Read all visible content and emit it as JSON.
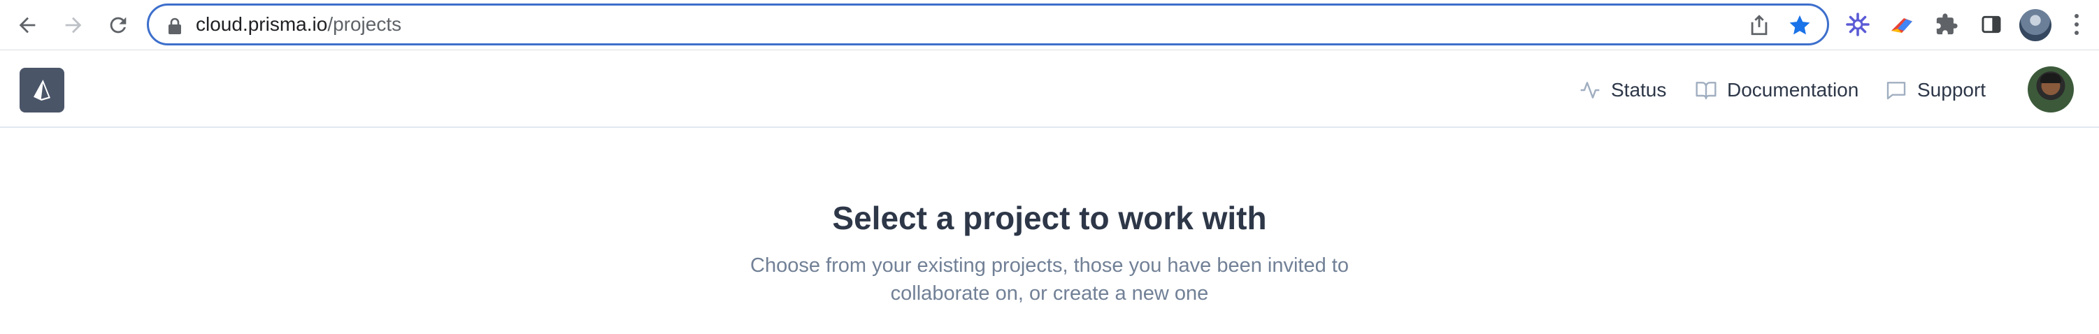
{
  "browser": {
    "url_domain": "cloud.prisma.io",
    "url_path": "/projects",
    "icons": [
      "back-icon",
      "forward-icon",
      "reload-icon",
      "lock-icon",
      "share-icon",
      "star-icon",
      "perplexity-extension-icon",
      "arrow-extension-icon",
      "puzzle-icon",
      "side-panel-icon",
      "profile-avatar",
      "kebab-menu-icon"
    ],
    "accent_color": "#3d6fcc"
  },
  "header": {
    "logo_icon": "prisma-logo-icon",
    "links": [
      {
        "label": "Status",
        "icon": "activity-icon"
      },
      {
        "label": "Documentation",
        "icon": "book-icon"
      },
      {
        "label": "Support",
        "icon": "chat-icon"
      }
    ]
  },
  "main": {
    "title": "Select a project to work with",
    "subtitle_line1": "Choose from your existing projects, those you have been invited to",
    "subtitle_line2": "collaborate on, or create a new one"
  }
}
